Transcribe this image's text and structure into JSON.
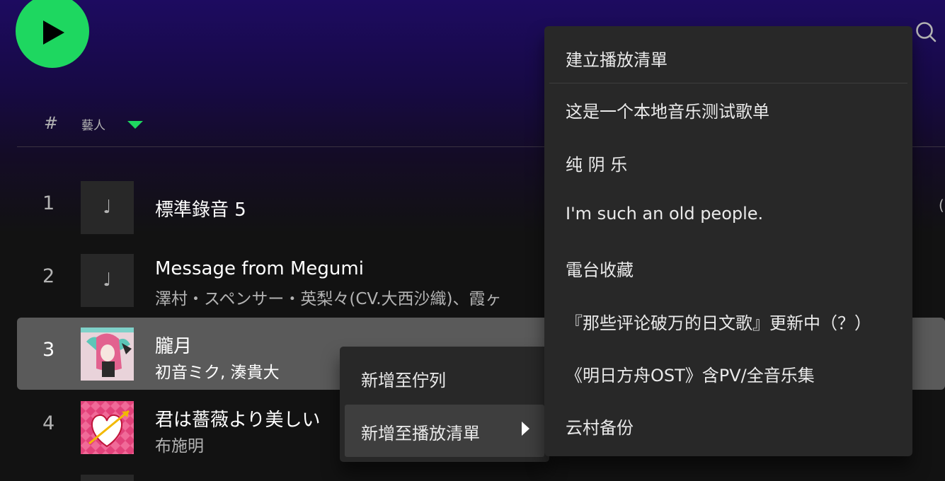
{
  "colors": {
    "accent": "#1ed760",
    "menu_bg": "#282828",
    "selected_row": "#5a5a5a"
  },
  "header": {
    "hash_label": "#",
    "artist_label": "藝人"
  },
  "tracks": [
    {
      "number": "1",
      "title": "標準錄音 5",
      "artist": "",
      "art": "music-note-placeholder"
    },
    {
      "number": "2",
      "title": "Message from Megumi",
      "artist": "澤村・スペンサー・英梨々(CV.大西沙織)、霞ヶ",
      "art": "music-note-placeholder"
    },
    {
      "number": "3",
      "title": "朧月",
      "artist": "初音ミク, 湊貴大",
      "art": "album-art-pink-hair"
    },
    {
      "number": "4",
      "title": "君は薔薇より美しい",
      "artist": "布施明",
      "art": "album-art-heart"
    }
  ],
  "context_menu": {
    "items": [
      {
        "label": "新增至佇列"
      },
      {
        "label": "新增至播放清單"
      }
    ]
  },
  "playlist_submenu": {
    "create_label": "建立播放清單",
    "playlists": [
      "这是一个本地音乐测试歌单",
      "纯 阴 乐",
      "I'm such an old people.",
      "電台收藏",
      "『那些评论破万的日文歌』更新中（？）",
      "《明日方舟OST》含PV/全音乐集",
      "云村备份"
    ]
  }
}
